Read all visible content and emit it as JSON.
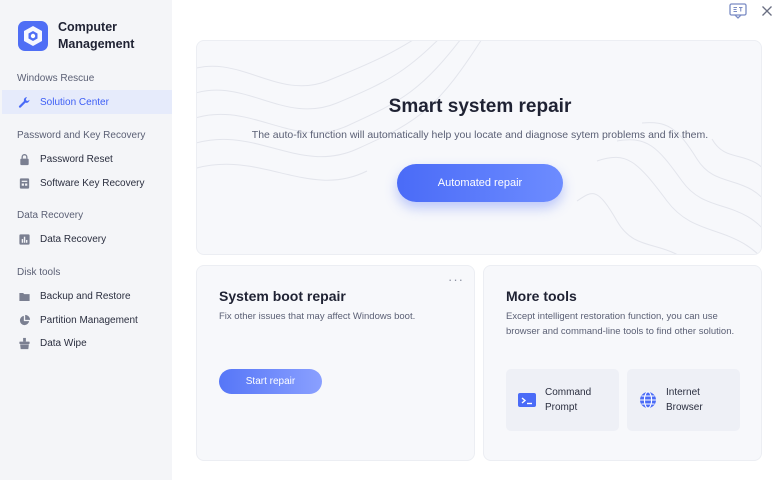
{
  "app": {
    "name": "Computer Management"
  },
  "sidebar": {
    "sections": [
      {
        "title": "Windows Rescue",
        "items": [
          {
            "label": "Solution Center",
            "icon": "wrench-icon",
            "active": true
          }
        ]
      },
      {
        "title": "Password and Key Recovery",
        "items": [
          {
            "label": "Password Reset",
            "icon": "lock-icon"
          },
          {
            "label": "Software Key Recovery",
            "icon": "key-card-icon"
          }
        ]
      },
      {
        "title": "Data Recovery",
        "items": [
          {
            "label": "Data Recovery",
            "icon": "bar-chart-icon"
          }
        ]
      },
      {
        "title": "Disk tools",
        "items": [
          {
            "label": "Backup and Restore",
            "icon": "folder-icon"
          },
          {
            "label": "Partition Management",
            "icon": "pie-chart-icon"
          },
          {
            "label": "Data Wipe",
            "icon": "wipe-icon"
          }
        ]
      }
    ]
  },
  "hero": {
    "title": "Smart system repair",
    "description": "The auto-fix function will automatically help you locate and diagnose sytem problems and fix them.",
    "button": "Automated repair"
  },
  "boot_card": {
    "title": "System boot repair",
    "description": "Fix other issues that may affect Windows boot.",
    "button": "Start repair",
    "more": "···"
  },
  "tools_card": {
    "title": "More tools",
    "description": "Except intelligent restoration function, you can use browser and command-line tools to find other solution.",
    "tools": [
      {
        "label": "Command Prompt",
        "icon": "terminal-icon"
      },
      {
        "label": "Internet Browser",
        "icon": "globe-icon"
      }
    ]
  },
  "colors": {
    "accent": "#4a6bf7",
    "sidebar_bg": "#f4f5f8",
    "active_bg": "#e6ebfb"
  }
}
